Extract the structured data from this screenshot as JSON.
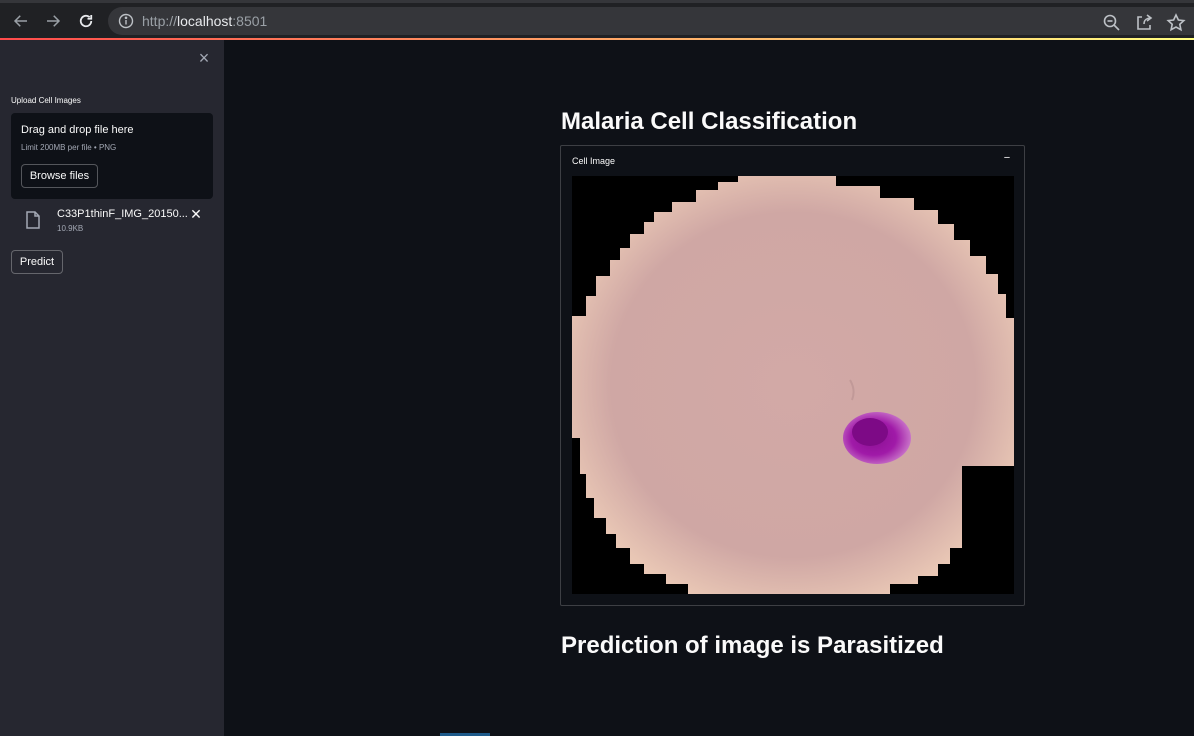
{
  "browser": {
    "url_scheme": "http://",
    "url_host": "localhost",
    "url_port": ":8501"
  },
  "sidebar": {
    "uploader_label": "Upload Cell Images",
    "dropzone_title": "Drag and drop file here",
    "dropzone_limit": "Limit 200MB per file • PNG",
    "browse_label": "Browse files",
    "file": {
      "name": "C33P1thinF_IMG_20150...",
      "size": "10.9KB"
    },
    "predict_label": "Predict"
  },
  "main": {
    "title": "Malaria Cell Classification",
    "expander_title": "Cell Image",
    "expander_toggle": "−",
    "prediction": "Prediction of image is Parasitized"
  }
}
